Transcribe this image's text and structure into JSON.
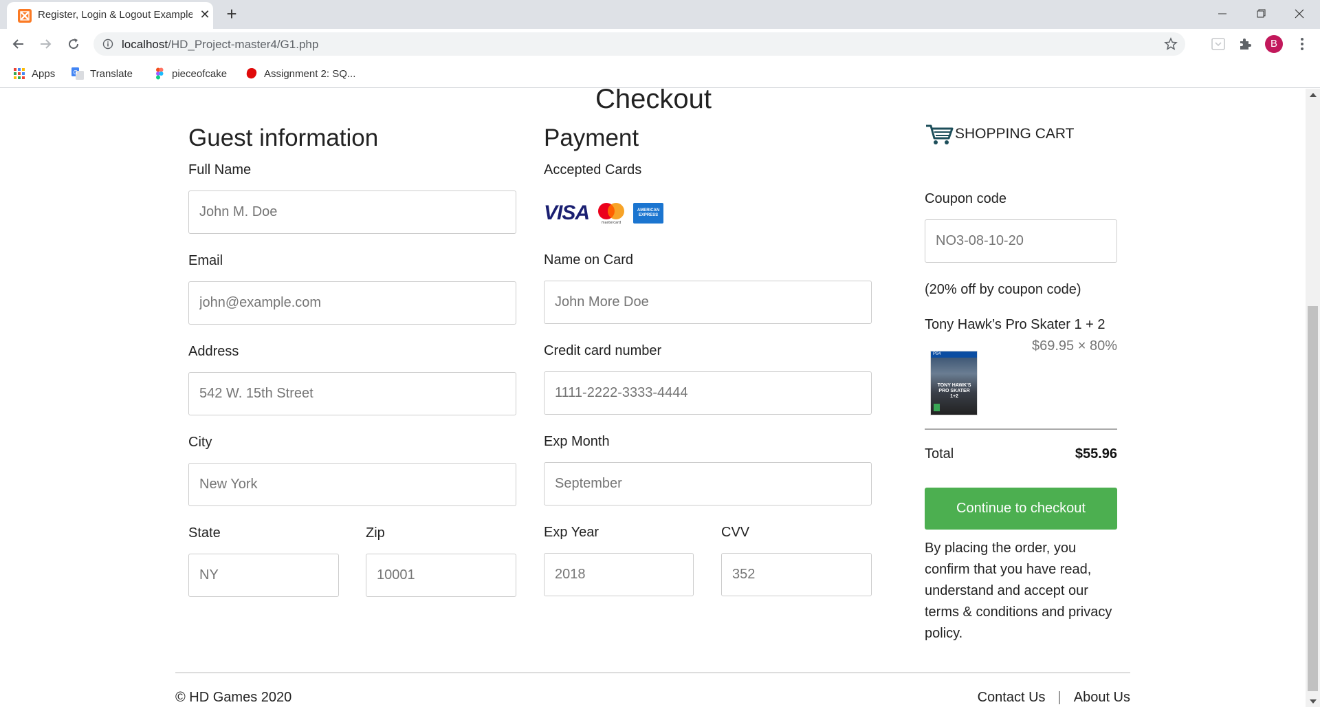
{
  "browser": {
    "tab_title": "Register, Login & Logout Example",
    "new_tab_label": "+",
    "url_host": "localhost",
    "url_path": "/HD_Project-master4/G1.php",
    "profile_initial": "B",
    "bookmarks": [
      "Apps",
      "Translate",
      "pieceofcake",
      "Assignment 2: SQ..."
    ]
  },
  "page": {
    "title": "Checkout"
  },
  "guest": {
    "heading": "Guest information",
    "full_name_label": "Full Name",
    "full_name_placeholder": "John M. Doe",
    "email_label": "Email",
    "email_placeholder": "john@example.com",
    "address_label": "Address",
    "address_placeholder": "542 W. 15th Street",
    "city_label": "City",
    "city_placeholder": "New York",
    "state_label": "State",
    "state_placeholder": "NY",
    "zip_label": "Zip",
    "zip_placeholder": "10001"
  },
  "payment": {
    "heading": "Payment",
    "accepted_cards_label": "Accepted Cards",
    "cards": [
      "VISA",
      "mastercard",
      "AMERICAN EXPRESS"
    ],
    "name_on_card_label": "Name on Card",
    "name_on_card_placeholder": "John More Doe",
    "card_number_label": "Credit card number",
    "card_number_placeholder": "1111-2222-3333-4444",
    "exp_month_label": "Exp Month",
    "exp_month_placeholder": "September",
    "exp_year_label": "Exp Year",
    "exp_year_placeholder": "2018",
    "cvv_label": "CVV",
    "cvv_placeholder": "352"
  },
  "cart": {
    "heading": "SHOPPING CART",
    "coupon_label": "Coupon code",
    "coupon_placeholder": "NO3-08-10-20",
    "coupon_note": "(20% off by coupon code)",
    "product_name": "Tony Hawk’s Pro Skater 1 + 2",
    "product_price": "$69.95 × 80%",
    "product_box_platform": "PS4",
    "product_box_title": "TONY HAWK'S PRO SKATER 1+2",
    "total_label": "Total",
    "total_value": "$55.96",
    "checkout_button": "Continue to checkout",
    "terms": "By placing the order, you confirm that you have read, understand and accept our terms & conditions and privacy policy."
  },
  "footer": {
    "copyright": "© HD Games 2020",
    "contact": "Contact Us",
    "separator": "|",
    "about": "About Us"
  },
  "colors": {
    "checkout_button": "#4caf50",
    "profile_avatar": "#c2185b",
    "favicon": "#fb7a24"
  }
}
